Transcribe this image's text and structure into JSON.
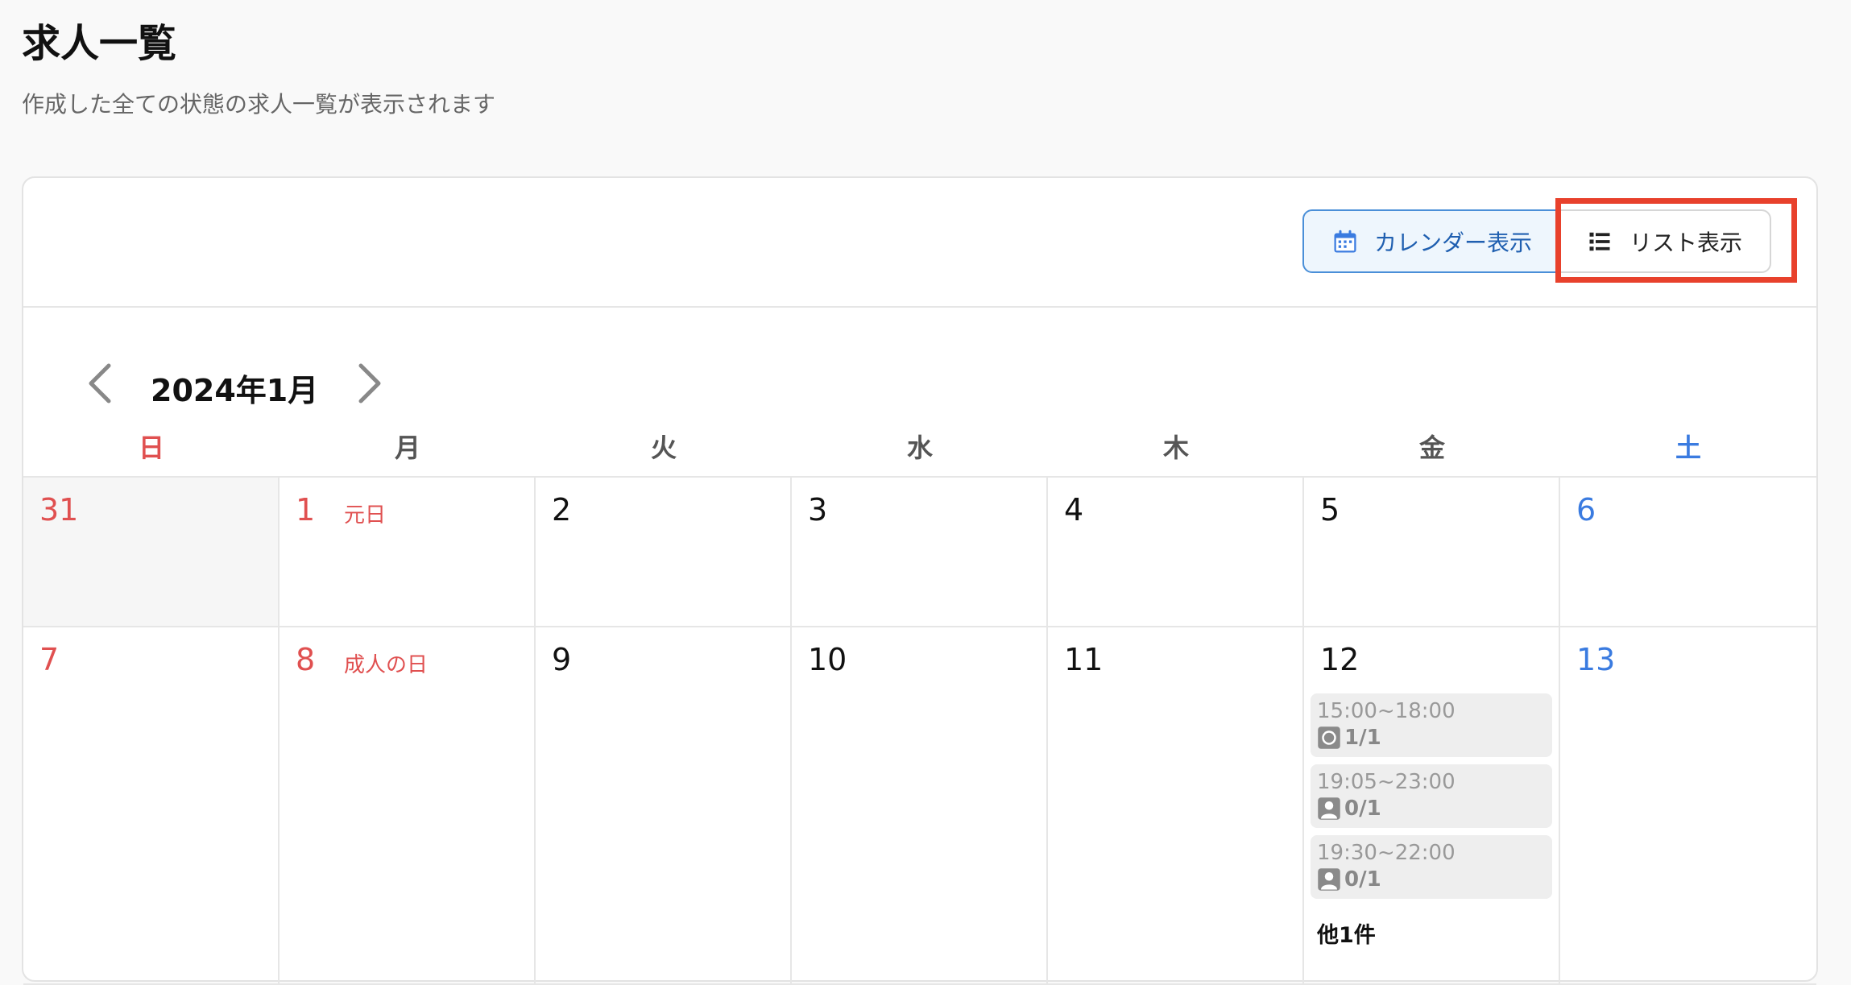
{
  "header": {
    "title": "求人一覧",
    "subtitle": "作成した全ての状態の求人一覧が表示されます"
  },
  "view_toggle": {
    "calendar_label": "カレンダー表示",
    "list_label": "リスト表示",
    "calendar_icon": "calendar-icon",
    "list_icon": "list-icon",
    "highlighted": "リスト表示"
  },
  "calendar": {
    "month_label": "2024年1月",
    "weekdays": [
      "日",
      "月",
      "火",
      "水",
      "木",
      "金",
      "土"
    ],
    "week1": [
      {
        "day": "31",
        "holiday": ""
      },
      {
        "day": "1",
        "holiday": "元日"
      },
      {
        "day": "2",
        "holiday": ""
      },
      {
        "day": "3",
        "holiday": ""
      },
      {
        "day": "4",
        "holiday": ""
      },
      {
        "day": "5",
        "holiday": ""
      },
      {
        "day": "6",
        "holiday": ""
      }
    ],
    "week2": [
      {
        "day": "7",
        "holiday": ""
      },
      {
        "day": "8",
        "holiday": "成人の日"
      },
      {
        "day": "9",
        "holiday": ""
      },
      {
        "day": "10",
        "holiday": ""
      },
      {
        "day": "11",
        "holiday": ""
      },
      {
        "day": "12",
        "holiday": ""
      },
      {
        "day": "13",
        "holiday": ""
      }
    ],
    "events_12": [
      {
        "time": "15:00~18:00",
        "count": "1/1",
        "icon": "circle-status-icon"
      },
      {
        "time": "19:05~23:00",
        "count": "0/1",
        "icon": "person-icon"
      },
      {
        "time": "19:30~22:00",
        "count": "0/1",
        "icon": "person-icon"
      }
    ],
    "more_12": "他1件"
  },
  "colors": {
    "sunday": "#e05050",
    "saturday": "#3a7be0",
    "accent": "#1f5fb0",
    "highlight": "#e8412c"
  }
}
